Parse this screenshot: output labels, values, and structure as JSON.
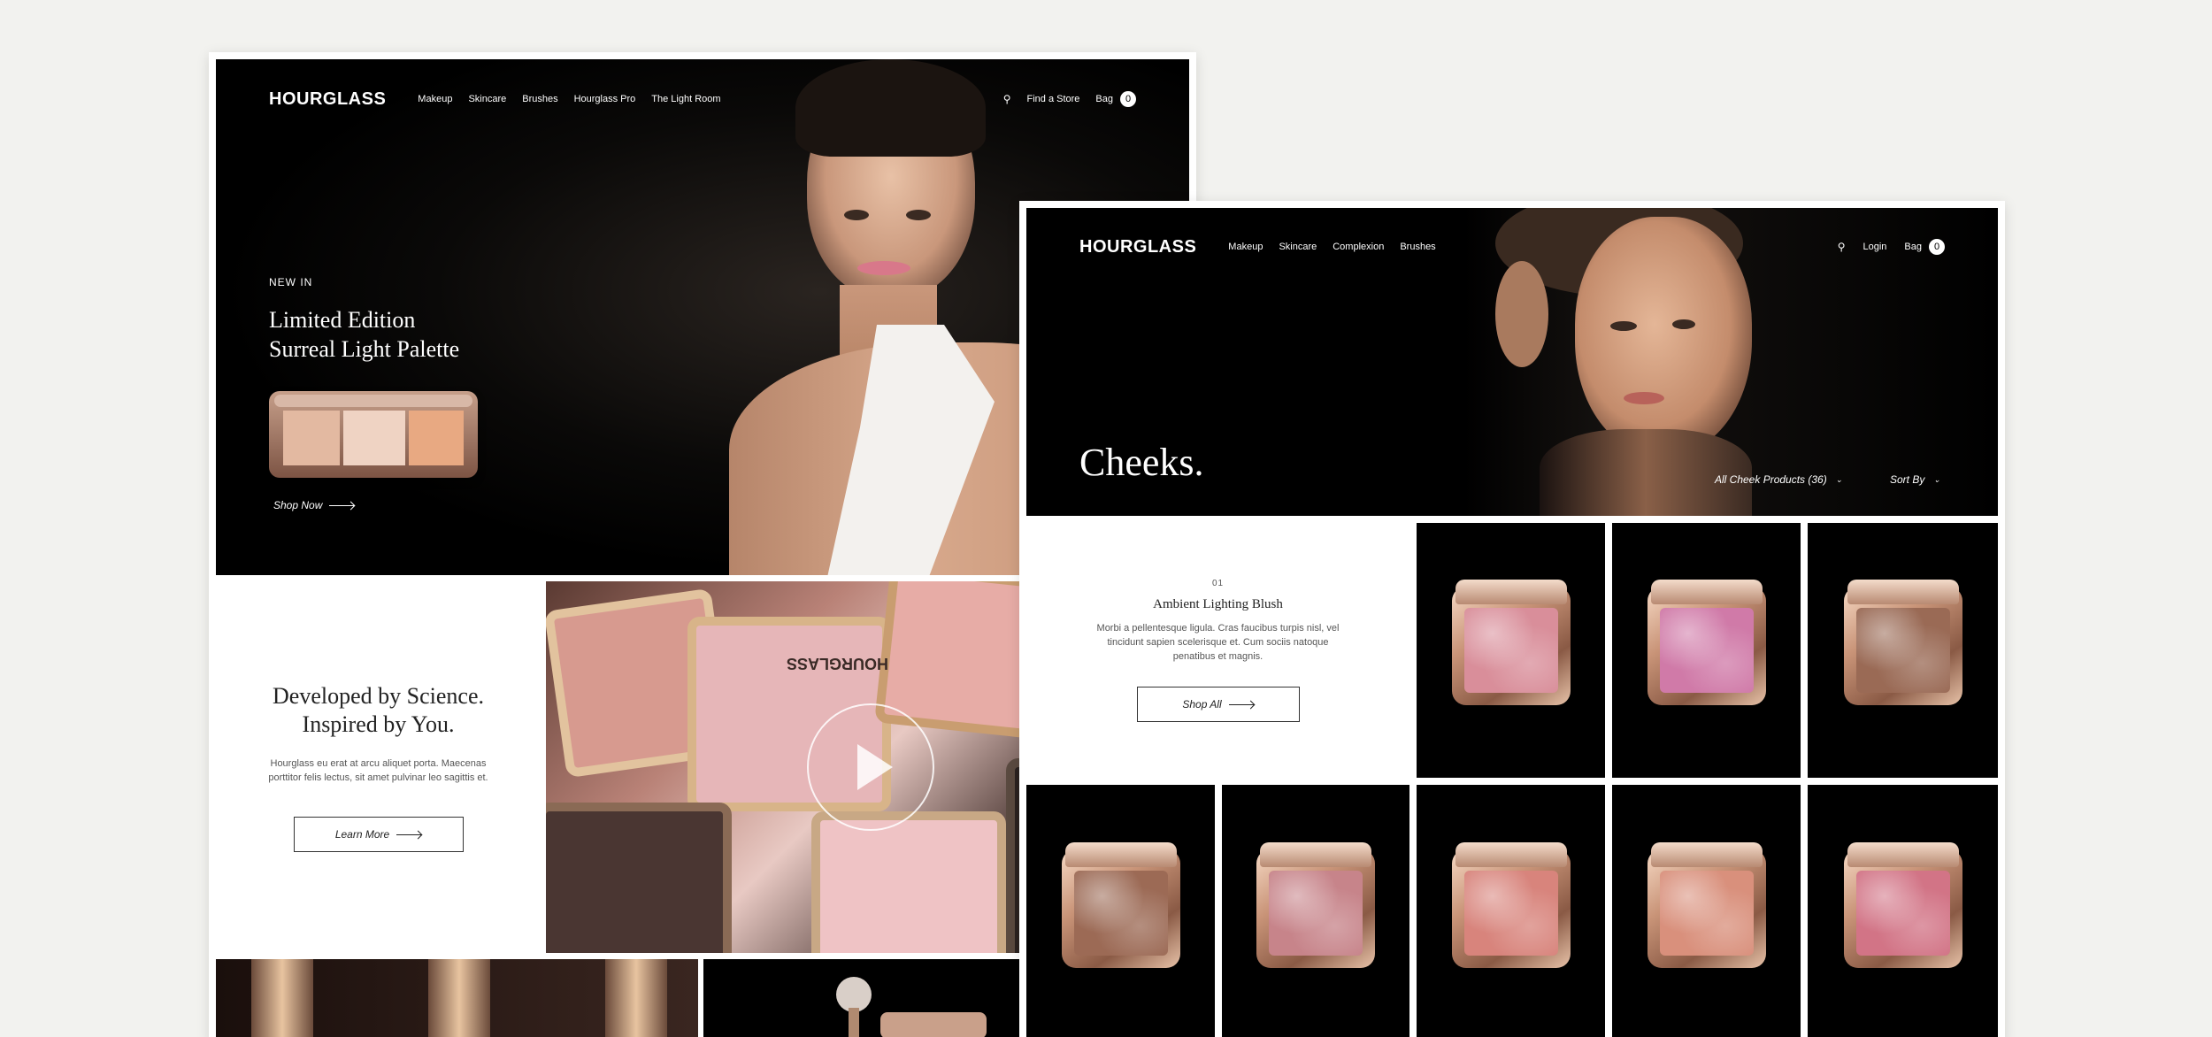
{
  "site1": {
    "logo": "HOURGLASS",
    "nav": [
      "Makeup",
      "Skincare",
      "Brushes",
      "Hourglass Pro",
      "The Light Room"
    ],
    "find_store": "Find a Store",
    "bag_label": "Bag",
    "bag_count": "0",
    "hero": {
      "eyebrow": "NEW IN",
      "title_line1": "Limited Edition",
      "title_line2": "Surreal Light Palette",
      "cta": "Shop Now"
    },
    "science": {
      "title_line1": "Developed by Science.",
      "title_line2": "Inspired by You.",
      "body": "Hourglass eu erat at arcu aliquet porta. Maecenas porttitor felis lectus, sit amet pulvinar leo sagittis et.",
      "cta": "Learn More"
    },
    "video_watermark": "HOURGLASS"
  },
  "site2": {
    "logo": "HOURGLASS",
    "nav": [
      "Makeup",
      "Skincare",
      "Complexion",
      "Brushes"
    ],
    "login": "Login",
    "bag_label": "Bag",
    "bag_count": "0",
    "hero_title": "Cheeks.",
    "filter": "All Cheek Products (36)",
    "sort": "Sort By",
    "feature": {
      "index": "01",
      "title": "Ambient Lighting Blush",
      "body": "Morbi a pellentesque ligula. Cras faucibus turpis nisl, vel tincidunt sapien scelerisque et. Cum sociis natoque penatibus et magnis.",
      "cta": "Shop All"
    },
    "product_colors": [
      "#d98e9a",
      "#d07aa8",
      "#9a6a55",
      "#9c6a55",
      "#c7848a",
      "#d8847c",
      "#d9907c",
      "#d27486"
    ]
  }
}
